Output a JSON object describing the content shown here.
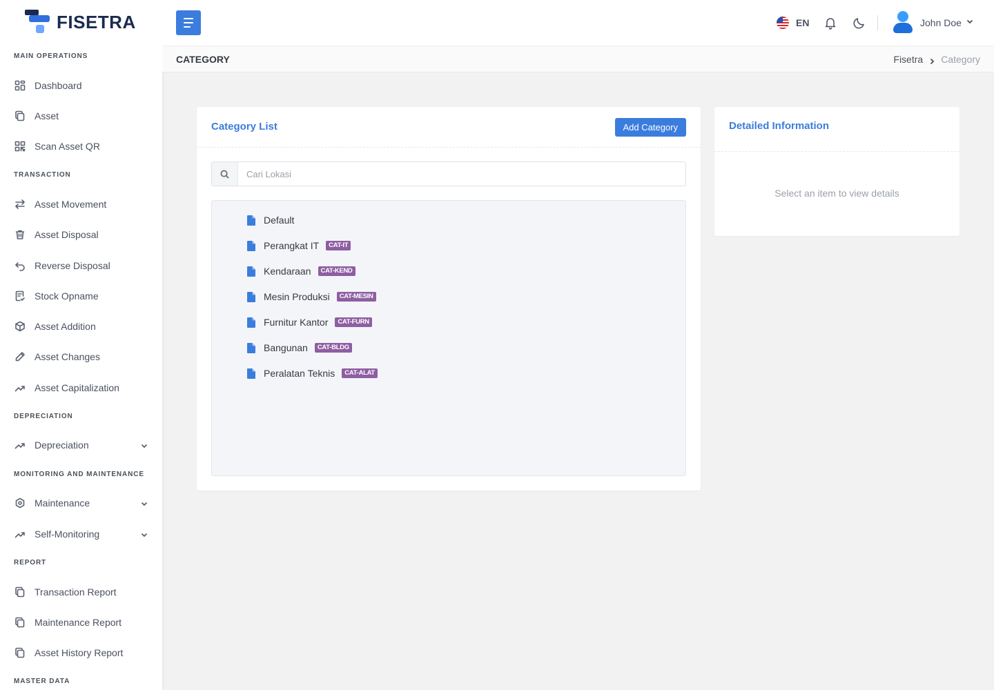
{
  "app": {
    "brand": "FISETRA"
  },
  "sidebar": {
    "sections": {
      "main": "MAIN OPERATIONS",
      "transaction": "TRANSACTION",
      "depreciation": "DEPRECIATION",
      "monitoring": "MONITORING AND MAINTENANCE",
      "report": "REPORT",
      "master": "MASTER DATA"
    },
    "items": {
      "dashboard": "Dashboard",
      "asset": "Asset",
      "scan_qr": "Scan Asset QR",
      "asset_movement": "Asset Movement",
      "asset_disposal": "Asset Disposal",
      "reverse_disposal": "Reverse Disposal",
      "stock_opname": "Stock Opname",
      "asset_addition": "Asset Addition",
      "asset_changes": "Asset Changes",
      "asset_capitalization": "Asset Capitalization",
      "depreciation": "Depreciation",
      "maintenance": "Maintenance",
      "self_monitoring": "Self-Monitoring",
      "transaction_report": "Transaction Report",
      "maintenance_report": "Maintenance Report",
      "asset_history_report": "Asset History Report"
    }
  },
  "topbar": {
    "lang_code": "EN",
    "user_name": "John Doe"
  },
  "page": {
    "title": "CATEGORY",
    "breadcrumb": {
      "home": "Fisetra",
      "current": "Category"
    }
  },
  "category_list": {
    "title": "Category List",
    "add_label": "Add Category",
    "search_placeholder": "Cari Lokasi",
    "items": [
      {
        "name": "Default",
        "code": ""
      },
      {
        "name": "Perangkat IT",
        "code": "CAT-IT"
      },
      {
        "name": "Kendaraan",
        "code": "CAT-KEND"
      },
      {
        "name": "Mesin Produksi",
        "code": "CAT-MESIN"
      },
      {
        "name": "Furnitur Kantor",
        "code": "CAT-FURN"
      },
      {
        "name": "Bangunan",
        "code": "CAT-BLDG"
      },
      {
        "name": "Peralatan Teknis",
        "code": "CAT-ALAT"
      }
    ]
  },
  "detail": {
    "title": "Detailed Information",
    "empty_message": "Select an item to view details"
  },
  "colors": {
    "primary": "#3b7ddd",
    "badge": "#8e5ea2",
    "brand_dark": "#1b2a4e"
  }
}
